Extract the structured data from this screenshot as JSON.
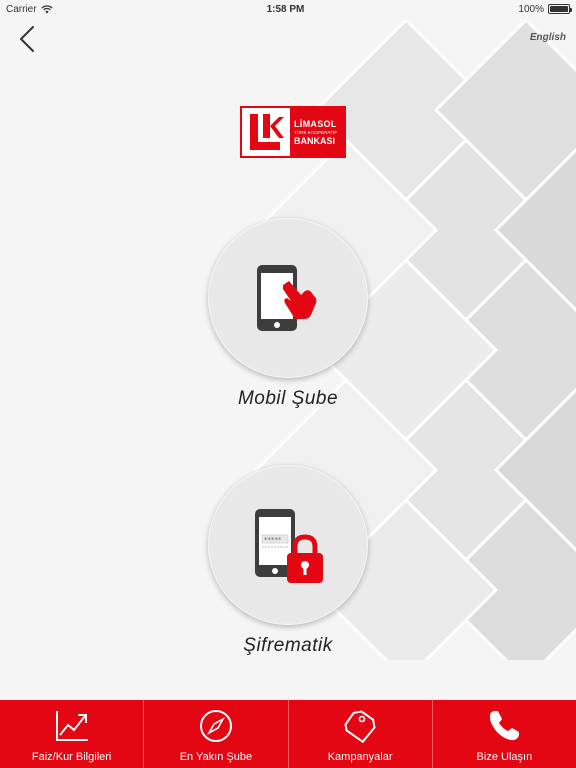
{
  "status_bar": {
    "carrier": "Carrier",
    "time": "1:58 PM",
    "battery": "100%"
  },
  "header": {
    "back_icon": "chevron-left-icon",
    "language_link": "English"
  },
  "logo": {
    "line1": "LİMASOL",
    "line2": "TÜRK KOOPERATİF",
    "line3": "BANKASI"
  },
  "features": [
    {
      "label": "Mobil Şube",
      "icon": "phone-touch-icon"
    },
    {
      "label": "Şifrematik",
      "icon": "phone-lock-icon"
    }
  ],
  "tabbar": {
    "items": [
      {
        "label": "Faiz/Kur Bilgileri",
        "icon": "chart-icon"
      },
      {
        "label": "En Yakın Şube",
        "icon": "compass-icon"
      },
      {
        "label": "Kampanyalar",
        "icon": "tag-icon"
      },
      {
        "label": "Bize Ulaşın",
        "icon": "phone-icon"
      }
    ]
  },
  "colors": {
    "brand_red": "#e30613",
    "background": "#f5f5f5",
    "circle": "#e8e8e8"
  }
}
